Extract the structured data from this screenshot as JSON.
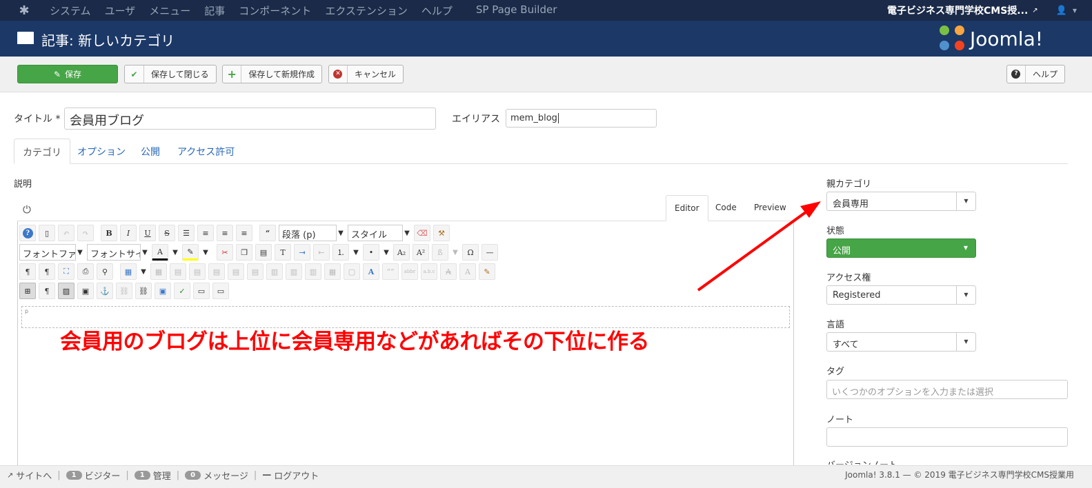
{
  "topnav": {
    "menu": [
      "システム",
      "ユーザ",
      "メニュー",
      "記事",
      "コンポーネント",
      "エクステンション",
      "ヘルプ"
    ],
    "sp_page_builder": "SP Page Builder",
    "site_name": "電子ビジネス専門学校CMS授..."
  },
  "header": {
    "title": "記事: 新しいカテゴリ",
    "brand": "Joomla!"
  },
  "toolbar": {
    "save": "保存",
    "save_close": "保存して閉じる",
    "save_new": "保存して新規作成",
    "cancel": "キャンセル",
    "help": "ヘルプ"
  },
  "form": {
    "title_label": "タイトル *",
    "title_value": "会員用ブログ",
    "alias_label": "エイリアス",
    "alias_value": "mem_blog"
  },
  "tabs": [
    "カテゴリ",
    "オプション",
    "公開",
    "アクセス許可"
  ],
  "description_label": "説明",
  "editor": {
    "tabs": [
      "Editor",
      "Code",
      "Preview"
    ],
    "paragraph_select": "段落 (p)",
    "style_select": "スタイル",
    "font_family_select": "フォントファ",
    "font_size_select": "フォントサイ",
    "path_marker": "p"
  },
  "annotation": {
    "text": "会員用のブログは上位に会員専用などがあればその下位に作る",
    "color": "#ff0000"
  },
  "sidebar": {
    "parent_label": "親カテゴリ",
    "parent_value": "会員専用",
    "status_label": "状態",
    "status_value": "公開",
    "access_label": "アクセス権",
    "access_value": "Registered",
    "language_label": "言語",
    "language_value": "すべて",
    "tags_label": "タグ",
    "tags_placeholder": "いくつかのオプションを入力または選択",
    "note_label": "ノート",
    "version_note_label": "バージョンノート"
  },
  "statusbar": {
    "site": "サイトへ",
    "visitors_count": "1",
    "visitors": "ビジター",
    "admin_count": "1",
    "admin": "管理",
    "messages_count": "0",
    "messages": "メッセージ",
    "logout": "ログアウト",
    "footer": "Joomla! 3.8.1 — © 2019 電子ビジネス専門学校CMS授業用"
  },
  "colors": {
    "topnav_bg": "#1a2a48",
    "header_bg": "#1b3867",
    "save_green": "#46a546",
    "link_blue": "#2a69b8"
  }
}
